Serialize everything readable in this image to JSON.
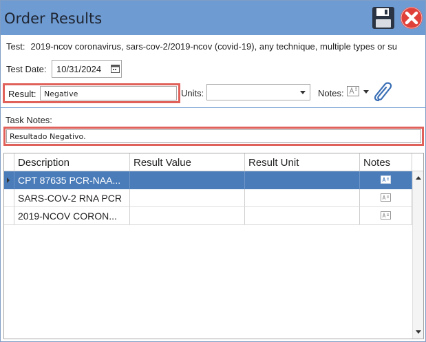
{
  "window": {
    "title": "Order Results"
  },
  "test": {
    "label": "Test:",
    "value": "2019-ncov coronavirus, sars-cov-2/2019-ncov (covid-19), any technique, multiple types or su"
  },
  "test_date": {
    "label": "Test Date:",
    "value": "10/31/2024"
  },
  "result": {
    "label": "Result:",
    "value": "Negative"
  },
  "units": {
    "label": "Units:",
    "value": ""
  },
  "notes": {
    "label": "Notes:"
  },
  "task_notes": {
    "label": "Task Notes:",
    "value": "Resultado Negativo."
  },
  "grid": {
    "columns": [
      "Description",
      "Result Value",
      "Result Unit",
      "Notes"
    ],
    "rows": [
      {
        "description": "CPT 87635 PCR-NAA...",
        "result_value": "",
        "result_unit": "",
        "selected": true
      },
      {
        "description": "SARS-COV-2 RNA PCR",
        "result_value": "",
        "result_unit": "",
        "selected": false
      },
      {
        "description": "2019-NCOV CORON...",
        "result_value": "",
        "result_unit": "",
        "selected": false
      }
    ]
  },
  "colors": {
    "titlebar": "#6f9bd3",
    "selected_row": "#4a7cba",
    "highlight_border": "#e0605a",
    "close": "#e0403a"
  },
  "icons": [
    "save-icon",
    "close-icon",
    "calendar-icon",
    "note-icon",
    "paperclip-icon"
  ]
}
